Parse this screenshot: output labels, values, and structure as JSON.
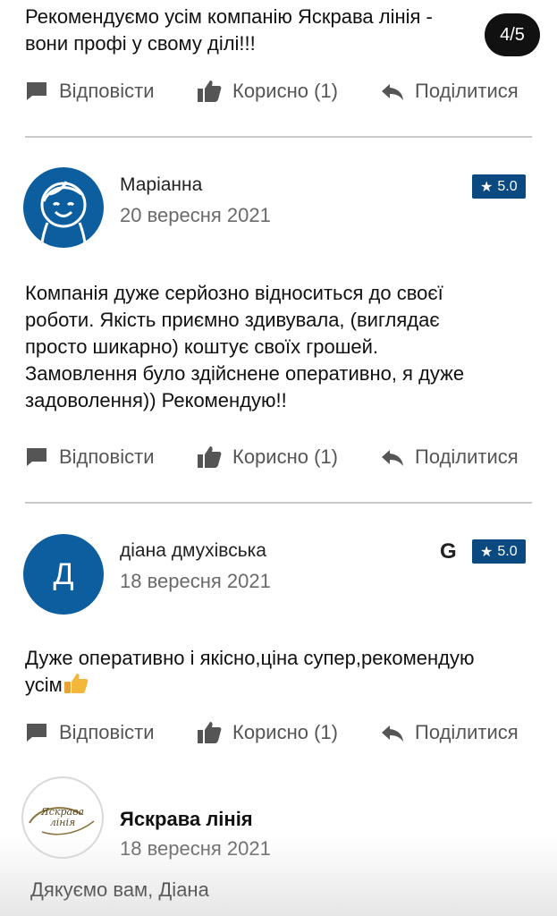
{
  "pager": "4/5",
  "reviews": [
    {
      "text_lines": [
        "Рекомендуємо усім компанію Яскрава лінія -",
        "вони профі у свому ділі!!!"
      ]
    },
    {
      "name": "Маріанна",
      "date": "20 вересня 2021",
      "rating": "5.0",
      "text_lines": [
        "Компанія дуже серйозно відноситься до своєї",
        "роботи. Якість приємно здивувала, (виглядає",
        "просто шикарно) коштує своїх грошей.",
        "Замовлення було здійснене оперативно, я дуже",
        "задоволення)) Рекомендую!!"
      ]
    },
    {
      "name": "діана дмухівська",
      "avatar_letter": "Д",
      "source_icon": "G",
      "date": "18 вересня 2021",
      "rating": "5.0",
      "text_lines": [
        "Дуже оперативно і якісно,ціна супер,рекомендую",
        "усім"
      ]
    }
  ],
  "reply": {
    "name": "Яскрава лінія",
    "logo_text": "Яскрава лінія",
    "date": "18 вересня 2021",
    "text": "Дякуємо вам, Діана"
  },
  "actions": {
    "reply": "Відповісти",
    "helpful": "Корисно (1)",
    "share": "Поділитися"
  },
  "colors": {
    "accent": "#0b4a80",
    "avatar_blue": "#0d5e9e"
  }
}
